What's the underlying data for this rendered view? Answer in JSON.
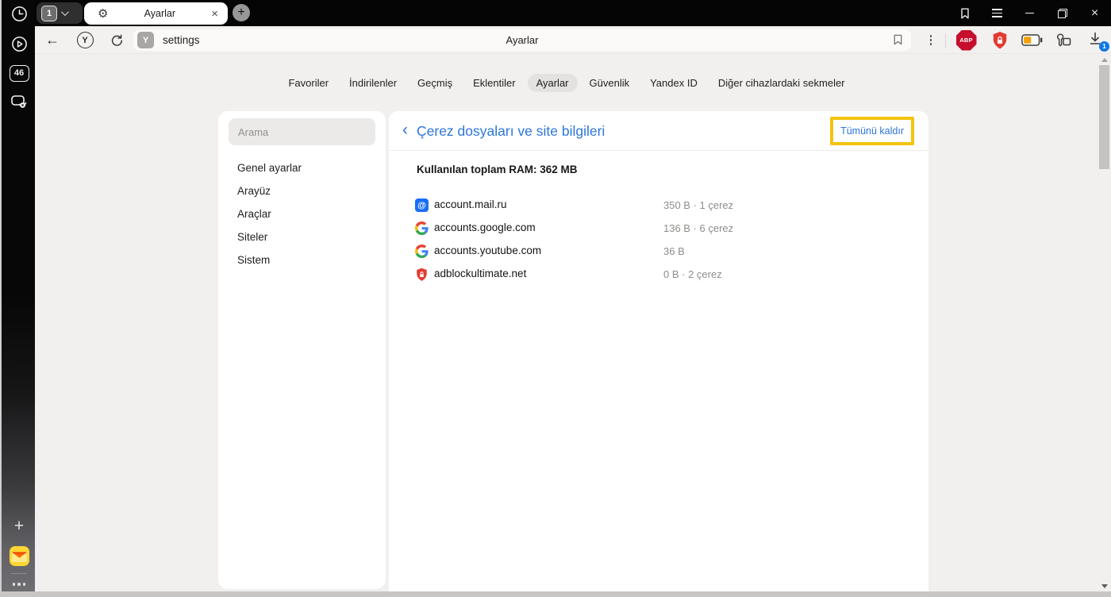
{
  "colors": {
    "accent_blue": "#2d76d9",
    "highlight_yellow": "#f3c40e",
    "download_badge_blue": "#0f78e8",
    "abp_red": "#c70d2c",
    "shield_red": "#e23c32",
    "battery_orange": "#f5a000",
    "mailru_blue": "#1a6ef5"
  },
  "tab_bar": {
    "tab_count": "1",
    "active_tab_title": "Ayarlar",
    "new_tab_label": "+",
    "close_label": "×"
  },
  "toolbar": {
    "back_label": "←",
    "yandex_button_label": "Y",
    "favicon_label": "Y",
    "url_text": "settings",
    "page_title": "Ayarlar",
    "abp_label": "ABP",
    "download_badge": "1"
  },
  "sidebar": {
    "counter_badge": "46",
    "plus_label": "+"
  },
  "nav_tabs": {
    "items": [
      {
        "label": "Favoriler"
      },
      {
        "label": "İndirilenler"
      },
      {
        "label": "Geçmiş"
      },
      {
        "label": "Eklentiler"
      },
      {
        "label": "Ayarlar"
      },
      {
        "label": "Güvenlik"
      },
      {
        "label": "Yandex ID"
      },
      {
        "label": "Diğer cihazlardaki sekmeler"
      }
    ],
    "active": "Ayarlar"
  },
  "settings_menu": {
    "search_placeholder": "Arama",
    "items": [
      {
        "label": "Genel ayarlar"
      },
      {
        "label": "Arayüz"
      },
      {
        "label": "Araçlar"
      },
      {
        "label": "Siteler"
      },
      {
        "label": "Sistem"
      }
    ]
  },
  "cookies_panel": {
    "back_chevron": "‹",
    "title": "Çerez dosyaları ve site bilgileri",
    "remove_all_label": "Tümünü kaldır",
    "ram_summary": "Kullanılan toplam RAM: 362 MB",
    "mailru_at": "@",
    "sites": [
      {
        "icon": "mailru-icon",
        "domain": "account.mail.ru",
        "info": "350 B · 1 çerez"
      },
      {
        "icon": "google-icon",
        "domain": "accounts.google.com",
        "info": "136 B · 6 çerez"
      },
      {
        "icon": "google-icon",
        "domain": "accounts.youtube.com",
        "info": "36 B"
      },
      {
        "icon": "adblock-shield-icon",
        "domain": "adblockultimate.net",
        "info": "0 B · 2 çerez"
      }
    ]
  }
}
